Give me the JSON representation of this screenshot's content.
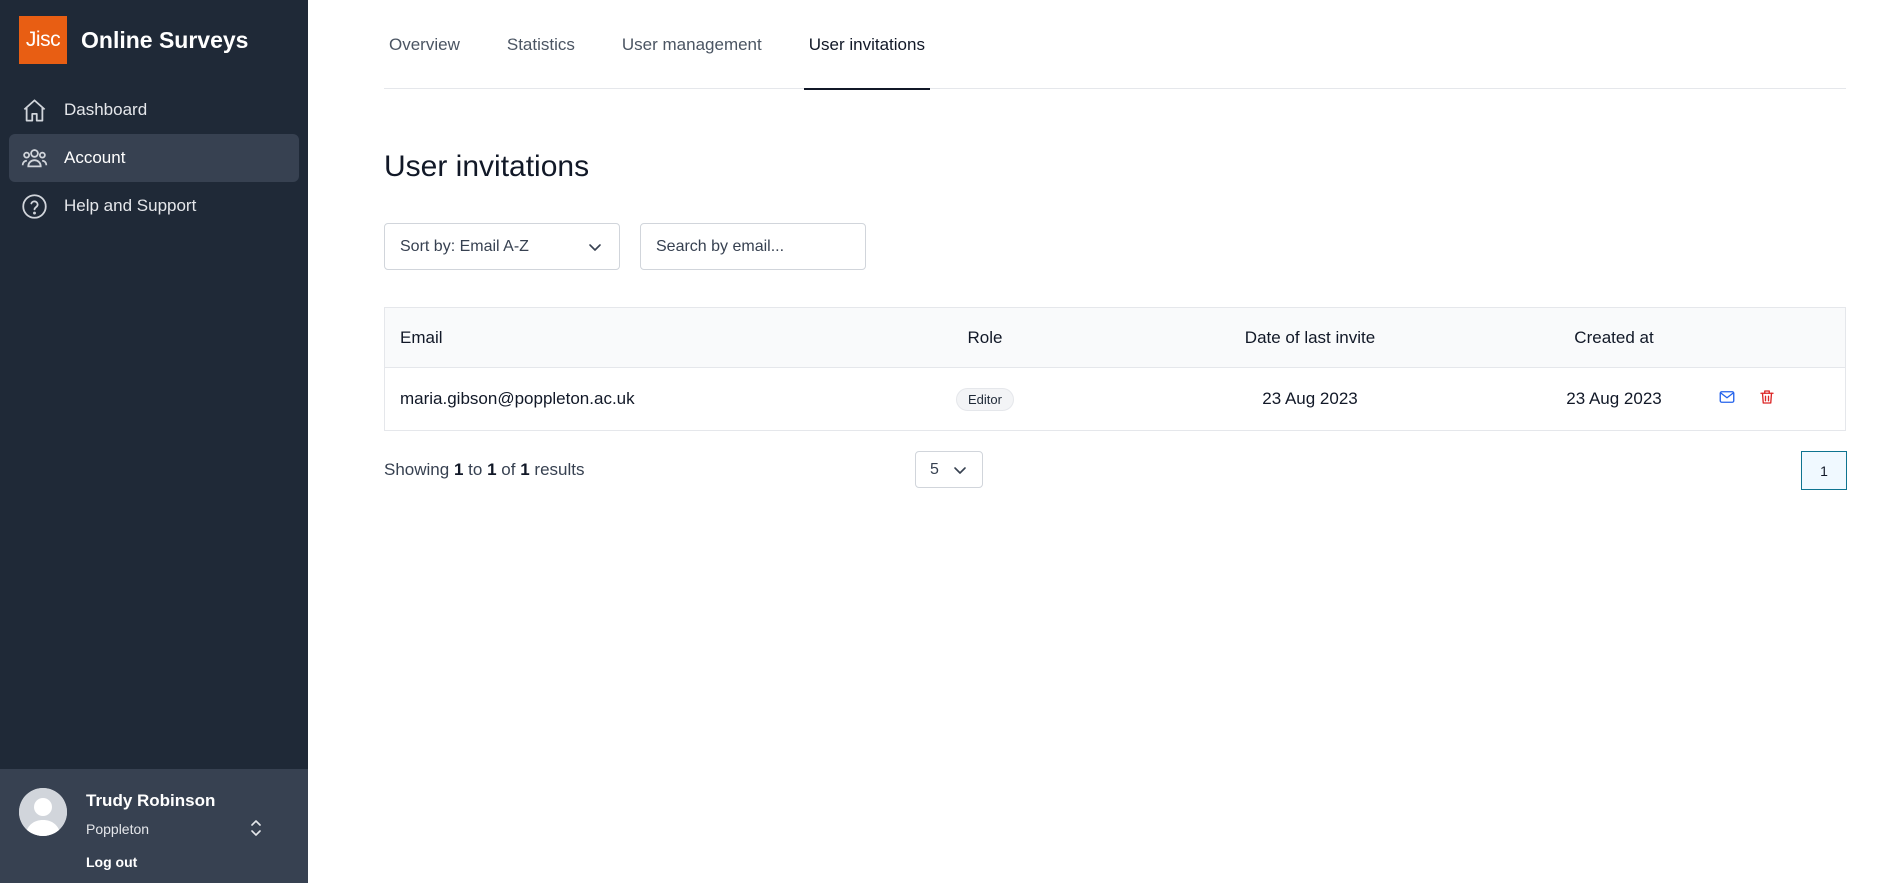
{
  "brand": {
    "logo_text": "Jisc",
    "name": "Online Surveys",
    "logo_color": "#e85e13"
  },
  "sidebar": {
    "items": [
      {
        "label": "Dashboard",
        "icon": "home-icon",
        "active": false
      },
      {
        "label": "Account",
        "icon": "users-icon",
        "active": true
      },
      {
        "label": "Help and Support",
        "icon": "help-circle-icon",
        "active": false
      }
    ]
  },
  "user": {
    "name": "Trudy Robinson",
    "org": "Poppleton",
    "logout_label": "Log out"
  },
  "tabs": [
    {
      "label": "Overview",
      "active": false
    },
    {
      "label": "Statistics",
      "active": false
    },
    {
      "label": "User management",
      "active": false
    },
    {
      "label": "User invitations",
      "active": true
    }
  ],
  "page": {
    "title": "User invitations",
    "sort_label": "Sort by: Email A-Z",
    "search_placeholder": "Search by email..."
  },
  "table": {
    "headers": {
      "email": "Email",
      "role": "Role",
      "last_invite": "Date of last invite",
      "created": "Created at"
    },
    "rows": [
      {
        "email": "maria.gibson@poppleton.ac.uk",
        "role": "Editor",
        "last_invite": "23 Aug 2023",
        "created": "23 Aug 2023"
      }
    ]
  },
  "pagination": {
    "showing_prefix": "Showing",
    "from": "1",
    "to_word": "to",
    "to": "1",
    "of_word": "of",
    "total": "1",
    "results_word": "results",
    "page_size": "5",
    "current_page": "1"
  },
  "colors": {
    "sidebar_bg": "#1f2937",
    "active_bg": "#374151",
    "resend_icon": "#2563eb",
    "delete_icon": "#dc2626"
  }
}
